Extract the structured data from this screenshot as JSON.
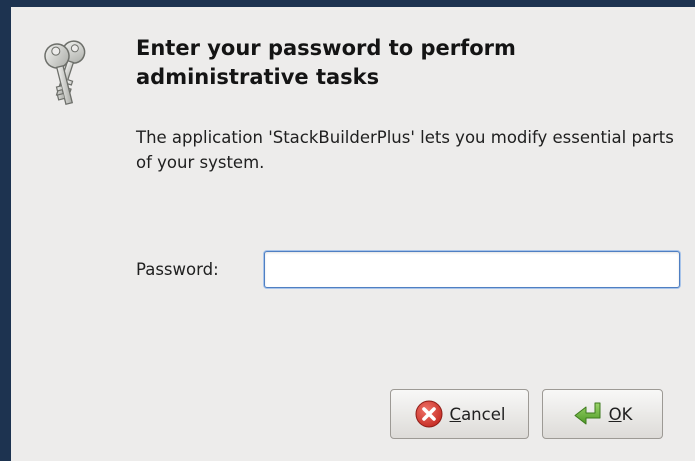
{
  "dialog": {
    "heading": "Enter your password to perform administrative tasks",
    "description": "The application 'StackBuilderPlus' lets you modify essential parts of your system.",
    "icon": "keys-icon",
    "password_label": "Password:",
    "password_value": "",
    "password_placeholder": ""
  },
  "buttons": {
    "cancel": {
      "mnemonic": "C",
      "rest": "ancel",
      "icon": "cancel-icon"
    },
    "ok": {
      "mnemonic": "O",
      "rest": "K",
      "icon": "enter-arrow-icon"
    }
  },
  "colors": {
    "background": "#edeceb",
    "input_focus_border": "#4f7fc2",
    "cancel_icon": "#d6332b",
    "ok_icon": "#6cb33f"
  }
}
